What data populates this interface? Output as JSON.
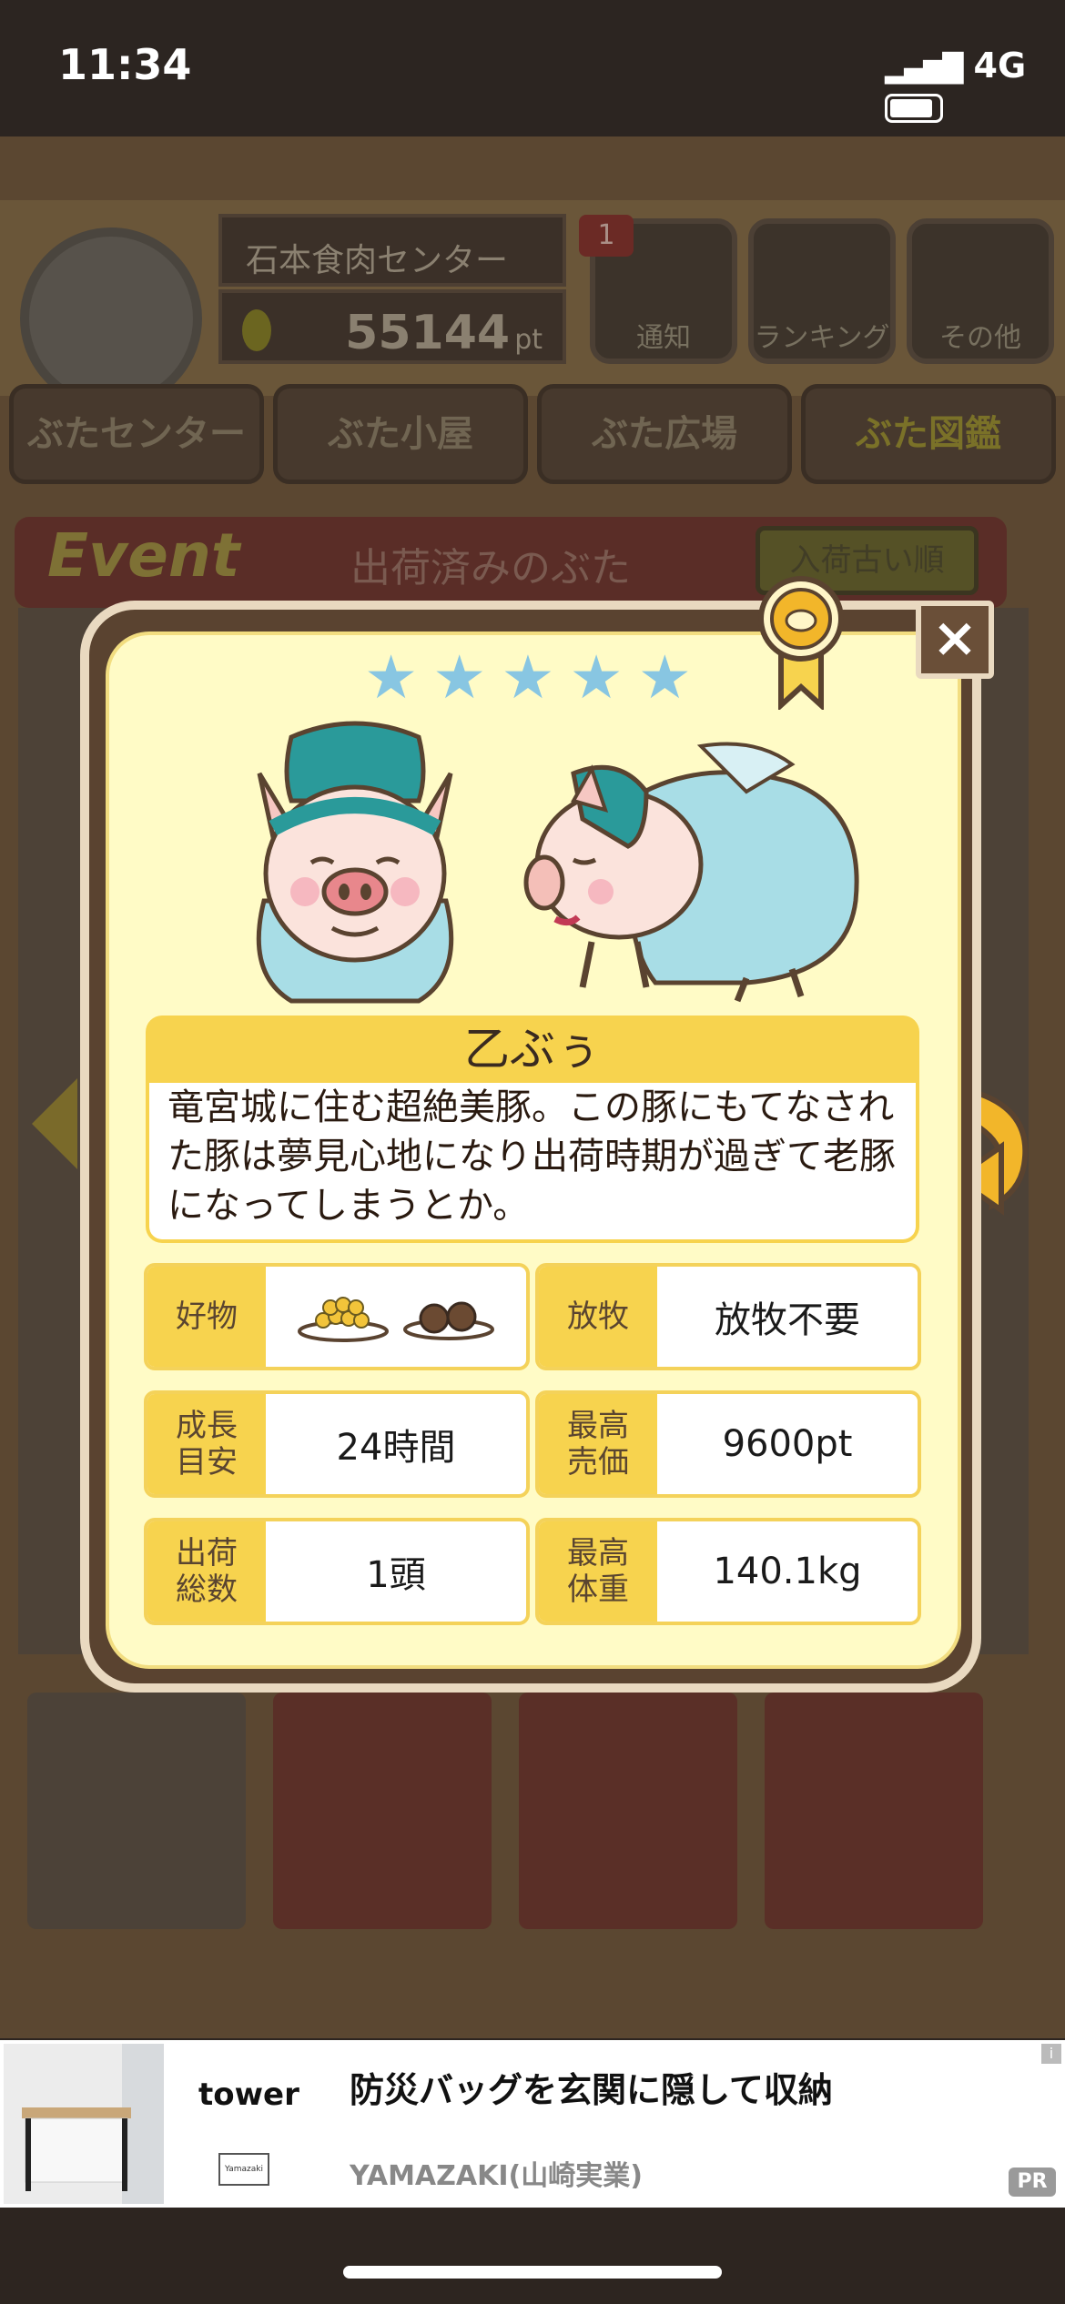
{
  "status": {
    "time": "11:34",
    "network": "4G"
  },
  "game": {
    "player_name": "石本食肉センター",
    "points_value": "55144",
    "points_unit": "pt",
    "notification_count": "1",
    "top_buttons": [
      "通知",
      "ランキング",
      "その他"
    ],
    "nav_tabs": [
      "ぶたセンター",
      "ぶた小屋",
      "ぶた広場",
      "ぶた図鑑"
    ],
    "event_word": "Event",
    "event_title": "出荷済みのぶた",
    "sort_label": "入荷古い順"
  },
  "modal": {
    "close_label": "×",
    "rating_stars": 5,
    "star_glyph": "★",
    "pig_name": "乙ぶぅ",
    "description": "竜宮城に住む超絶美豚。この豚にもてなされた豚は夢見心地になり出荷時期が過ぎて老豚になってしまうとか。",
    "stats": {
      "favorite": {
        "label": "好物",
        "value": ""
      },
      "pasture": {
        "label": "放牧",
        "value": "放牧不要"
      },
      "growth": {
        "label": "成長\n目安",
        "value": "24時間"
      },
      "max_price": {
        "label": "最高\n売価",
        "value": "9600pt"
      },
      "shipped": {
        "label": "出荷\n総数",
        "value": "1頭"
      },
      "max_weight": {
        "label": "最高\n体重",
        "value": "140.1kg"
      }
    }
  },
  "ad": {
    "brand": "tower",
    "brand_box": "Yamazaki",
    "title": "防災バッグを玄関に隠して収納",
    "advertiser": "YAMAZAKI(山崎実業)",
    "pr_label": "PR",
    "info_label": "i"
  },
  "colors": {
    "accent_yellow": "#f7d34e",
    "modal_bg": "#fffbc6",
    "star": "#88c6e2"
  }
}
